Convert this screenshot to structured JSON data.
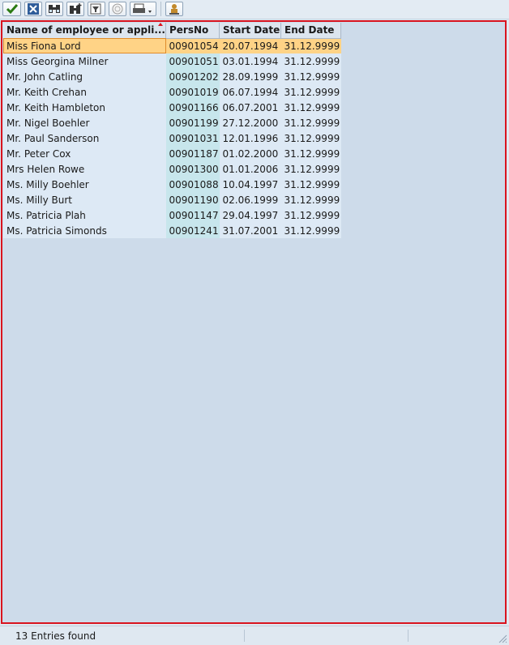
{
  "toolbar": {
    "buttons": [
      {
        "name": "continue-button",
        "icon": "checkmark-icon"
      },
      {
        "name": "cancel-button",
        "icon": "close-icon"
      },
      {
        "name": "find-button",
        "icon": "binoculars-icon"
      },
      {
        "name": "find-next-button",
        "icon": "binoculars-plus-icon"
      },
      {
        "name": "restrict-values-button",
        "icon": "filter-icon"
      },
      {
        "name": "information-button",
        "icon": "info-icon"
      },
      {
        "name": "print-button",
        "icon": "printer-icon"
      },
      {
        "name": "personal-list-button",
        "icon": "user-list-icon"
      }
    ]
  },
  "table": {
    "headers": [
      "Name of employee or appli...",
      "PersNo",
      "Start Date",
      "End Date"
    ],
    "rows": [
      {
        "name": "Miss Fiona Lord",
        "persno": "00901054",
        "start": "20.07.1994",
        "end": "31.12.9999"
      },
      {
        "name": "Miss Georgina Milner",
        "persno": "00901051",
        "start": "03.01.1994",
        "end": "31.12.9999"
      },
      {
        "name": "Mr. John Catling",
        "persno": "00901202",
        "start": "28.09.1999",
        "end": "31.12.9999"
      },
      {
        "name": "Mr. Keith Crehan",
        "persno": "00901019",
        "start": "06.07.1994",
        "end": "31.12.9999"
      },
      {
        "name": "Mr. Keith Hambleton",
        "persno": "00901166",
        "start": "06.07.2001",
        "end": "31.12.9999"
      },
      {
        "name": "Mr. Nigel Boehler",
        "persno": "00901199",
        "start": "27.12.2000",
        "end": "31.12.9999"
      },
      {
        "name": "Mr. Paul Sanderson",
        "persno": "00901031",
        "start": "12.01.1996",
        "end": "31.12.9999"
      },
      {
        "name": "Mr. Peter Cox",
        "persno": "00901187",
        "start": "01.02.2000",
        "end": "31.12.9999"
      },
      {
        "name": "Mrs Helen Rowe",
        "persno": "00901300",
        "start": "01.01.2006",
        "end": "31.12.9999"
      },
      {
        "name": "Ms. Milly Boehler",
        "persno": "00901088",
        "start": "10.04.1997",
        "end": "31.12.9999"
      },
      {
        "name": "Ms. Milly Burt",
        "persno": "00901190",
        "start": "02.06.1999",
        "end": "31.12.9999"
      },
      {
        "name": "Ms. Patricia Plah",
        "persno": "00901147",
        "start": "29.04.1997",
        "end": "31.12.9999"
      },
      {
        "name": "Ms. Patricia Simonds",
        "persno": "00901241",
        "start": "31.07.2001",
        "end": "31.12.9999"
      }
    ],
    "selected_row": 0
  },
  "status": {
    "text": "13 Entries found"
  },
  "colors": {
    "frame": "#d9141f",
    "selected_row": "#ffd386",
    "key_column": "#c7e6ec"
  }
}
